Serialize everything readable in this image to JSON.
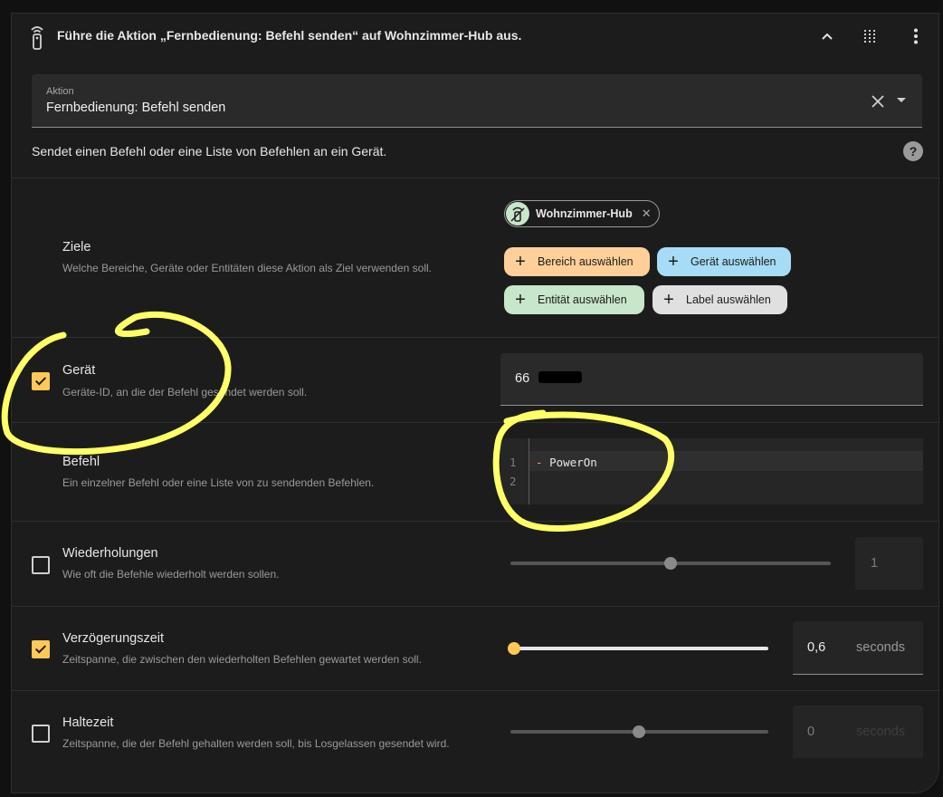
{
  "header": {
    "title": "Führe die Aktion „Fernbedienung: Befehl senden“ auf Wohnzimmer-Hub aus.",
    "icon": "remote-icon"
  },
  "action_field": {
    "label": "Aktion",
    "value": "Fernbedienung: Befehl senden"
  },
  "description": "Sendet einen Befehl oder eine Liste von Befehlen an ein Gerät.",
  "help_icon": "?",
  "targets": {
    "title": "Ziele",
    "subtitle": "Welche Bereiche, Geräte oder Entitäten diese Aktion als Ziel verwenden soll.",
    "chip_label": "Wohnzimmer-Hub",
    "buttons": {
      "area": "Bereich auswählen",
      "device": "Gerät auswählen",
      "entity": "Entität auswählen",
      "label": "Label auswählen"
    },
    "colors": {
      "area": "#ffcf99",
      "device": "#a6dcf5",
      "entity": "#c8e6c9",
      "label": "#e0e0e0"
    }
  },
  "device_row": {
    "title": "Gerät",
    "subtitle": "Geräte-ID, an die der Befehl gesendet werden soll.",
    "checked": true,
    "value": "66"
  },
  "command_row": {
    "title": "Befehl",
    "subtitle": "Ein einzelner Befehl oder eine Liste von zu sendenden Befehlen.",
    "line_numbers": [
      "1",
      "2"
    ],
    "code_dash": "-",
    "code_text": "PowerOn"
  },
  "repeats_row": {
    "title": "Wiederholungen",
    "subtitle": "Wie oft die Befehle wiederholt werden sollen.",
    "checked": false,
    "value": "1",
    "slider_level": 0.5
  },
  "delay_row": {
    "title": "Verzögerungszeit",
    "subtitle": "Zeitspanne, die zwischen den wiederholten Befehlen gewartet werden soll.",
    "checked": true,
    "value": "0,6",
    "unit": "seconds",
    "slider_level": 0.0
  },
  "hold_row": {
    "title": "Haltezeit",
    "subtitle": "Zeitspanne, die der Befehl gehalten werden soll, bis Losgelassen gesendet wird.",
    "checked": false,
    "value": "0",
    "unit": "seconds",
    "slider_level": 0.5
  },
  "colors": {
    "accent": "#ffc857",
    "annotation": "#ffff66",
    "background": "#1c1c1c"
  }
}
